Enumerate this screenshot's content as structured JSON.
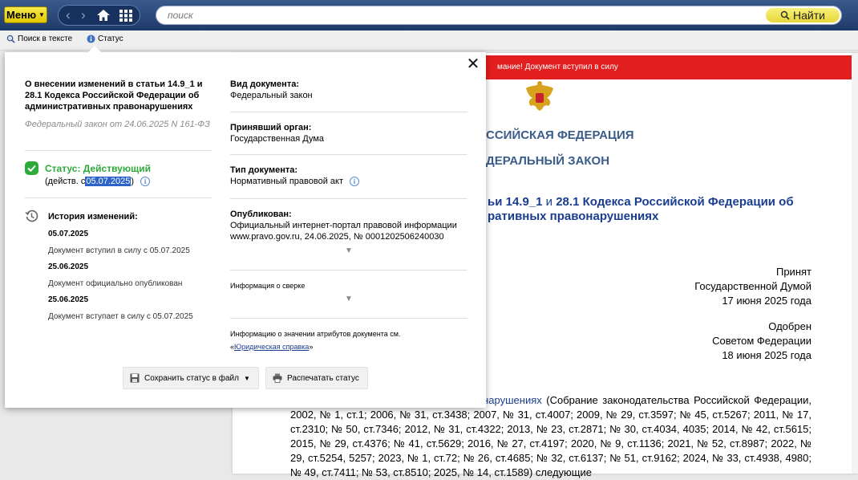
{
  "topbar": {
    "menu_label": "Меню",
    "search_placeholder": "поиск",
    "find_label": "Найти"
  },
  "toolbar": {
    "search_in_text": "Поиск в тексте",
    "status": "Статус"
  },
  "document": {
    "banner": "мание! Документ вступил в силу",
    "heading_country": "ССИЙСКАЯ ФЕДЕРАЦИЯ",
    "heading_law": "ЕДЕРАЛЬНЫЙ ЗАКОН",
    "title_line1_bold": "ьи 14.9_1",
    "title_line1_and": " и ",
    "title_line1_rest": "28.1 Кодекса Российской Федерации об",
    "title_line2": "ративных правонарушениях",
    "accepted": [
      "Принят",
      "Государственной Думой",
      "17 июня 2025 года"
    ],
    "approved": [
      "Одобрен",
      "Советом Федерации",
      "18 июня 2025 года"
    ],
    "body_link": "едерации об административных правонарушениях",
    "body_rest": " (Собрание законодательства Российской Федерации, 2002, № 1, ст.1; 2006, № 31, ст.3438; 2007, № 31, ст.4007; 2009, № 29, ст.3597; № 45, ст.5267; 2011, № 17, ст.2310; № 50, ст.7346; 2012, № 31, ст.4322; 2013, № 23, ст.2871; № 30, ст.4034, 4035; 2014, № 42, ст.5615; 2015, № 29, ст.4376; № 41, ст.5629; 2016, № 27, ст.4197; 2020, № 9, ст.1136; 2021, № 52, ст.8987; 2022, № 29, ст.5254, 5257; 2023, № 1, ст.72; № 26, ст.4685; № 32, ст.6137; № 51, ст.9162; 2024, № 33, ст.4938, 4980; № 49, ст.7411; № 53, ст.8510; 2025, № 14, ст.1589) следующие"
  },
  "popup": {
    "title": "О внесении изменений в статьи 14.9_1 и 28.1 Кодекса Российской Федерации об административных правонарушениях",
    "subtitle": "Федеральный закон от 24.06.2025 N 161-ФЗ",
    "status": "Статус: Действующий",
    "since_prefix": "(действ. с ",
    "since_date": "05.07.2025",
    "since_suffix": ")",
    "history_title": "История изменений:",
    "history": [
      {
        "date": "05.07.2025",
        "desc": "Документ вступил в силу с 05.07.2025"
      },
      {
        "date": "25.06.2025",
        "desc": "Документ официально опубликован"
      },
      {
        "date": "25.06.2025",
        "desc": "Документ вступает в силу с 05.07.2025"
      }
    ],
    "doc_type_label": "Вид документа:",
    "doc_type_value": "Федеральный закон",
    "body_label": "Принявший орган:",
    "body_value": "Государственная Дума",
    "kind_label": "Тип документа:",
    "kind_value": "Нормативный правовой акт",
    "published_label": "Опубликован:",
    "published_value": "Официальный интернет-портал правовой информации www.pravo.gov.ru, 24.06.2025, № 0001202506240030",
    "check_label": "Информация о сверке",
    "attr_info": "Информацию о значении атрибутов документа см.",
    "attr_link_open": "«",
    "attr_link": "Юридическая справка",
    "attr_link_close": "»",
    "save_btn": "Сохранить статус в файл",
    "print_btn": "Распечатать статус"
  }
}
